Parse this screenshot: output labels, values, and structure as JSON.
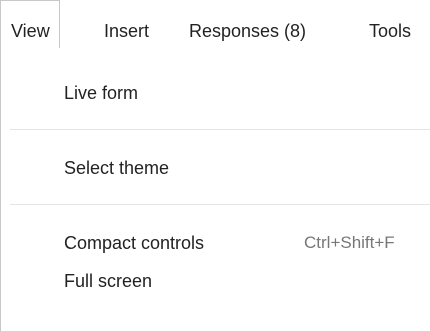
{
  "menubar": {
    "items": [
      {
        "label": "View",
        "active": true
      },
      {
        "label": "Insert"
      },
      {
        "label": "Responses (8)"
      },
      {
        "label": "Tools"
      }
    ]
  },
  "view_menu": {
    "items": [
      {
        "label": "Live form"
      },
      {
        "label": "Select theme"
      },
      {
        "label": "Compact controls",
        "shortcut": "Ctrl+Shift+F"
      },
      {
        "label": "Full screen"
      }
    ]
  },
  "colors": {
    "text": "#222222",
    "shortcut_text": "#777777",
    "border": "#c8c8c8",
    "separator": "#e5e5e5"
  }
}
